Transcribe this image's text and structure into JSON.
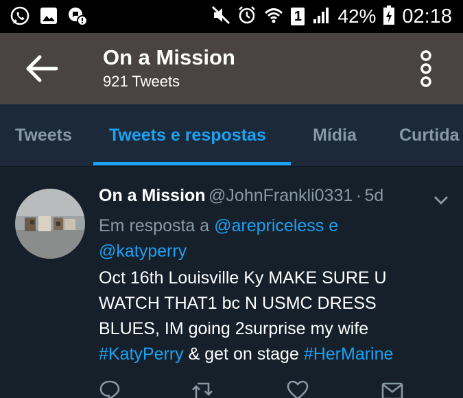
{
  "status_bar": {
    "battery": "42%",
    "time": "02:18",
    "sim_slot": "1",
    "icons": [
      "whatsapp-icon",
      "gallery-icon",
      "notification-icon",
      "mute-icon",
      "alarm-icon",
      "wifi-icon",
      "signal-icon",
      "battery-icon"
    ]
  },
  "header": {
    "title": "On a Mission",
    "subtitle": "921 Tweets"
  },
  "tabs": [
    {
      "label": "Tweets",
      "active": false
    },
    {
      "label": "Tweets e respostas",
      "active": true
    },
    {
      "label": "Mídia",
      "active": false
    },
    {
      "label": "Curtida",
      "active": false
    }
  ],
  "tweet": {
    "name": "On a Mission",
    "handle": "@JohnFrankli0331",
    "sep": "·",
    "age": "5d",
    "reply_prefix": "Em resposta a",
    "reply_mention_1": "@arepriceless",
    "reply_and": "e",
    "reply_mention_2": "@katyperry",
    "body_line_1": "Oct 16th Louisville Ky MAKE SURE U",
    "body_line_2": "WATCH THAT1 bc N USMC DRESS",
    "body_line_3": "BLUES, IM going 2surprise my wife",
    "hashtag_1": "#KatyPerry",
    "body_mid": "& get on stage",
    "hashtag_2": "#HerMarine"
  },
  "colors": {
    "background": "#15202b",
    "header": "#4a4343",
    "tabs": "#1c2938",
    "accent": "#1da1f2",
    "muted": "#8899a6"
  }
}
